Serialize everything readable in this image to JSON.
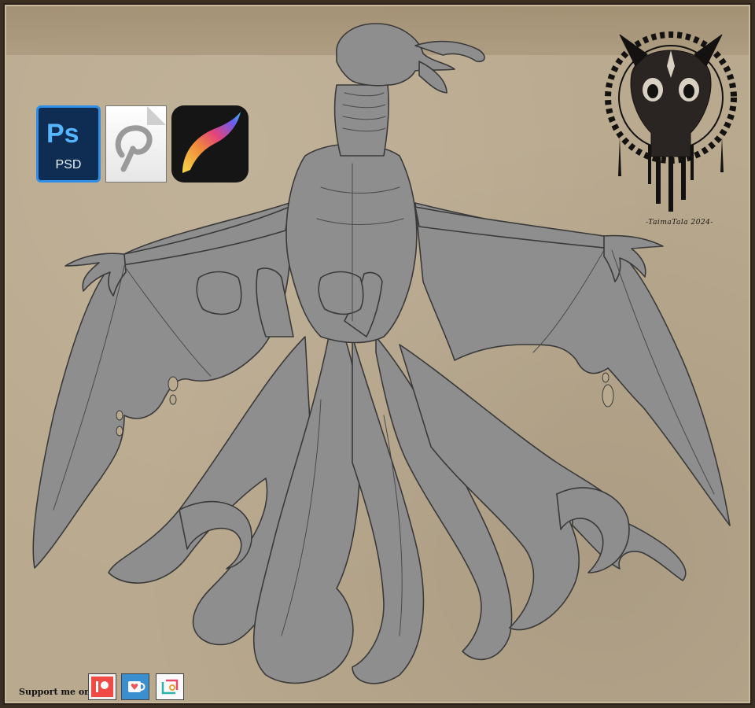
{
  "colors": {
    "background": "#b9a98e",
    "frame": "#3b2f24",
    "lineart_fill": "#8e8e8e",
    "lineart_stroke": "#3a3a3a",
    "photoshop_blue": "#2f8fe8",
    "kofi_blue": "#3a8fd0",
    "patreon_red": "#f04a44"
  },
  "app_icons": {
    "photoshop": {
      "icon": "photoshop-icon",
      "letters": "Ps",
      "extension": "PSD"
    },
    "clip_studio": {
      "icon": "clip-studio-icon"
    },
    "procreate": {
      "icon": "procreate-icon"
    }
  },
  "signature": {
    "logo": "skull-emblem-icon",
    "text": "-TaimaTala 2024-"
  },
  "support": {
    "label": "Support me on:",
    "platforms": [
      {
        "icon": "patreon-icon"
      },
      {
        "icon": "kofi-icon"
      },
      {
        "icon": "vgen-icon"
      }
    ]
  },
  "artwork": {
    "subject": "winged-tentacle-creature-lineart"
  }
}
